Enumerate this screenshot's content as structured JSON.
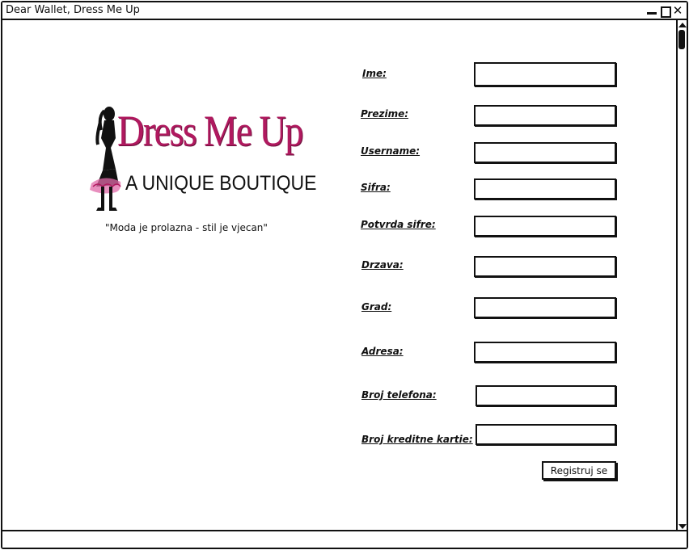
{
  "window": {
    "title": "Dear Wallet, Dress Me Up"
  },
  "logo": {
    "brand_name": "Dress Me Up",
    "tagline": "A UNIQUE BOUTIQUE",
    "brand_color": "#b0195f"
  },
  "motto": "\"Moda je prolazna - stil je vjecan\"",
  "form": {
    "fields": [
      {
        "label": "Ime:",
        "value": ""
      },
      {
        "label": "Prezime:",
        "value": ""
      },
      {
        "label": "Username:",
        "value": ""
      },
      {
        "label": "Sifra:",
        "value": ""
      },
      {
        "label": "Potvrda sifre:",
        "value": ""
      },
      {
        "label": "Drzava:",
        "value": ""
      },
      {
        "label": "Grad:",
        "value": ""
      },
      {
        "label": "Adresa:",
        "value": ""
      },
      {
        "label": "Broj telefona:",
        "value": ""
      },
      {
        "label": "Broj kreditne kartie:",
        "value": ""
      }
    ],
    "submit_label": "Registruj se"
  }
}
